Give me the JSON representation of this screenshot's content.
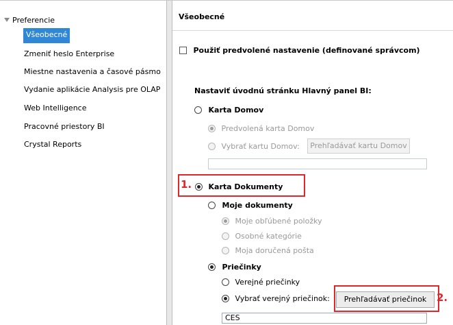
{
  "left_panel": {
    "root_label": "Preferencie",
    "items": [
      {
        "label": "Všeobecné",
        "selected": true
      },
      {
        "label": "Zmeniť heslo Enterprise"
      },
      {
        "label": "Miestne nastavenia a časové pásmo"
      },
      {
        "label": "Vydanie aplikácie Analysis pre OLAP"
      },
      {
        "label": "Web Intelligence"
      },
      {
        "label": "Pracovné priestory BI"
      },
      {
        "label": "Crystal Reports"
      }
    ]
  },
  "general": {
    "title": "Všeobecné",
    "use_default_label": "Použiť predvolené nastavenie (definované správcom)",
    "use_default_checked": false,
    "start_page_heading": "Nastaviť úvodnú stránku Hlavný panel BI:",
    "home_tab": {
      "label": "Karta Domov",
      "default_option": "Predvolená karta Domov",
      "select_option": "Vybrať kartu Domov:",
      "browse_button": "Prehľadávať kartu Domov",
      "field_value": ""
    },
    "documents_tab": {
      "label": "Karta Dokumenty",
      "my_documents": {
        "label": "Moje dokumenty",
        "options": [
          "Moje obľúbené položky",
          "Osobné kategórie",
          "Moja doručená pošta"
        ]
      },
      "folders": {
        "label": "Priečinky",
        "public_option": "Verejné priečinky",
        "select_option": "Vybrať verejný priečinok:",
        "browse_button": "Prehľadávať priečinok",
        "field_value": "CES"
      }
    }
  },
  "callouts": {
    "step1": "1.",
    "step2": "2.",
    "color": "#e0262b"
  },
  "colors": {
    "selection": "#2f87d6"
  }
}
